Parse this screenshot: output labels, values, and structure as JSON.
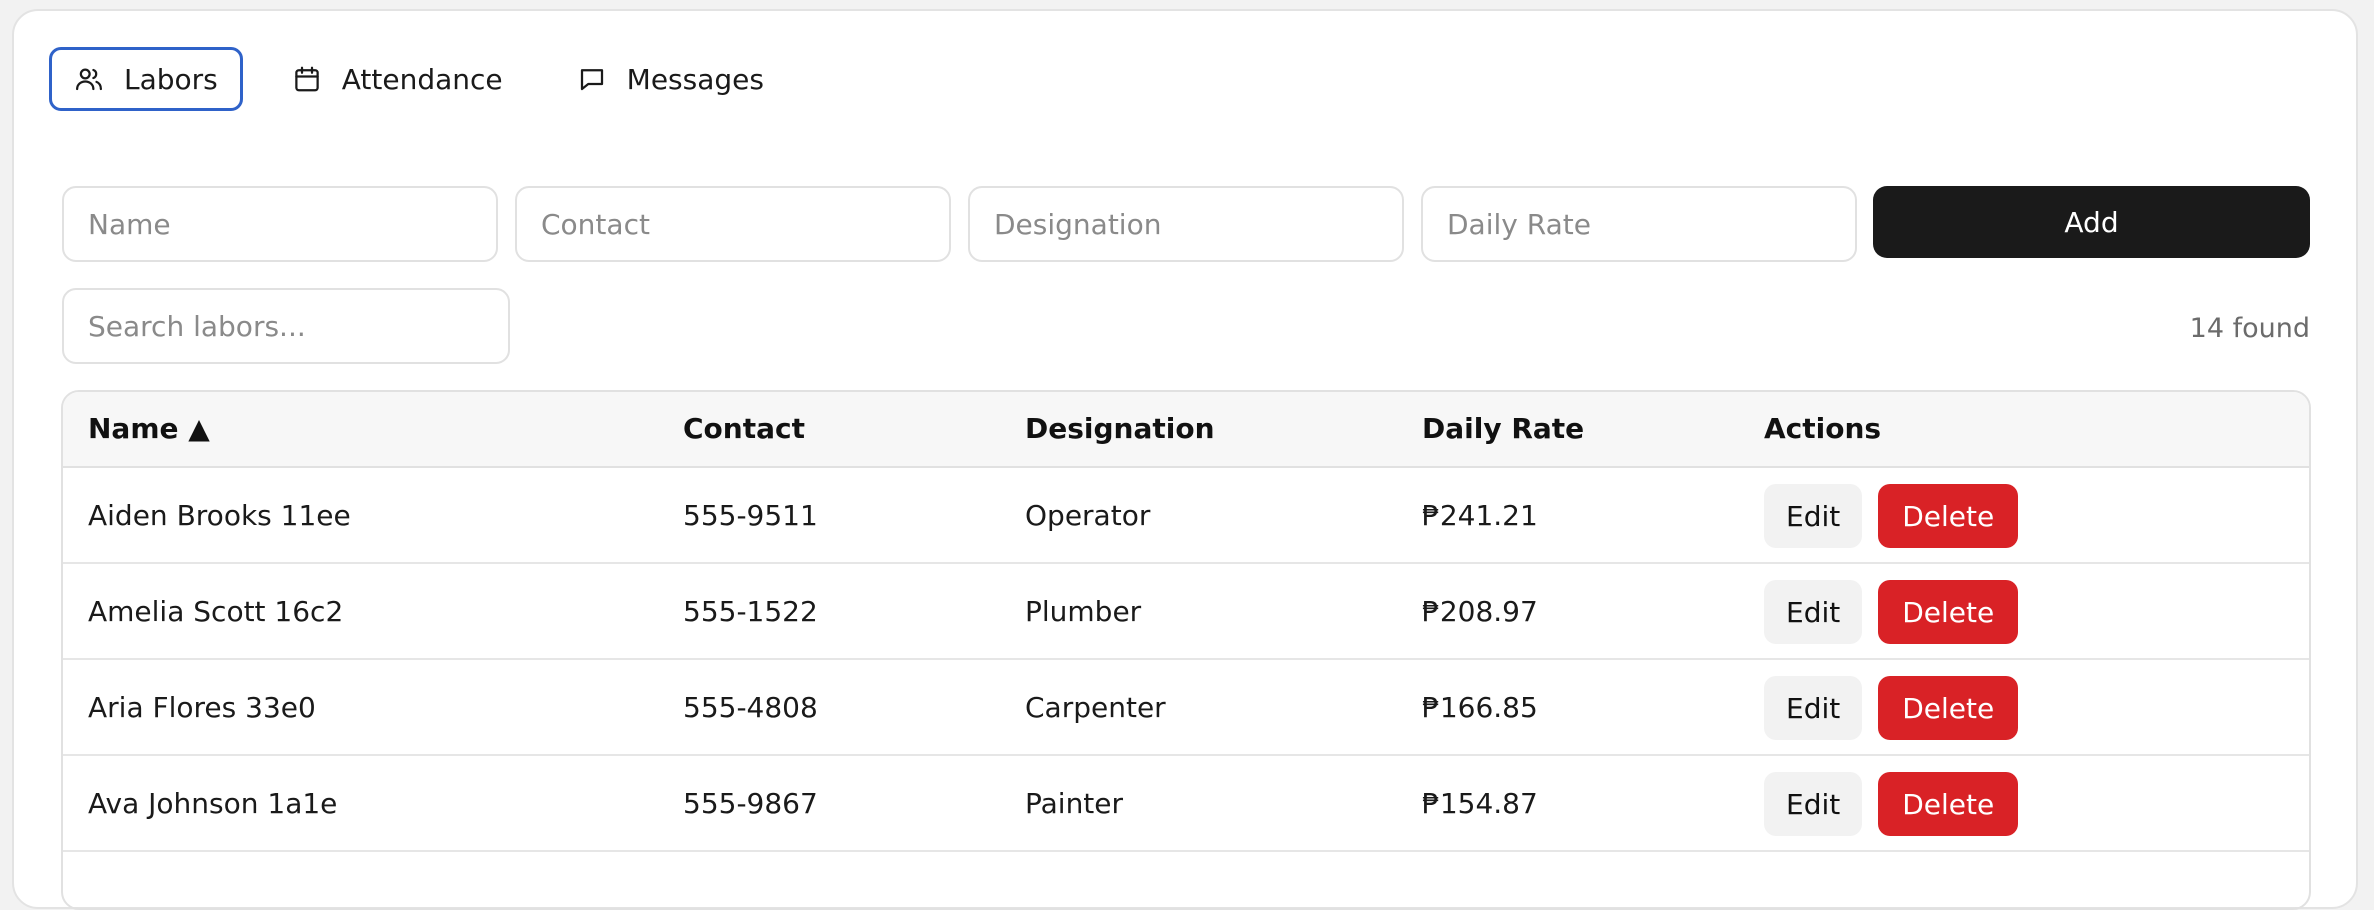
{
  "tabs": [
    {
      "label": "Labors",
      "icon": "users-icon",
      "active": true
    },
    {
      "label": "Attendance",
      "icon": "calendar-icon",
      "active": false
    },
    {
      "label": "Messages",
      "icon": "message-icon",
      "active": false
    }
  ],
  "form": {
    "name_placeholder": "Name",
    "contact_placeholder": "Contact",
    "designation_placeholder": "Designation",
    "rate_placeholder": "Daily Rate",
    "add_label": "Add"
  },
  "search": {
    "placeholder": "Search labors...",
    "count": "14 found"
  },
  "table": {
    "headers": {
      "name": "Name ▲",
      "contact": "Contact",
      "designation": "Designation",
      "rate": "Daily Rate",
      "actions": "Actions"
    },
    "edit_label": "Edit",
    "delete_label": "Delete",
    "rows": [
      {
        "name": "Aiden Brooks 11ee",
        "contact": "555-9511",
        "designation": "Operator",
        "rate": "₱241.21"
      },
      {
        "name": "Amelia Scott 16c2",
        "contact": "555-1522",
        "designation": "Plumber",
        "rate": "₱208.97"
      },
      {
        "name": "Aria Flores 33e0",
        "contact": "555-4808",
        "designation": "Carpenter",
        "rate": "₱166.85"
      },
      {
        "name": "Ava Johnson 1a1e",
        "contact": "555-9867",
        "designation": "Painter",
        "rate": "₱154.87"
      }
    ]
  },
  "colors": {
    "accent": "#2f62c9",
    "primary": "#1a1a1a",
    "danger": "#d92226"
  }
}
